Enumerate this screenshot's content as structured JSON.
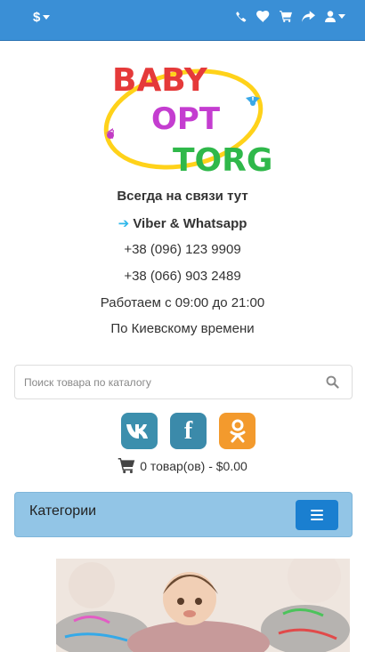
{
  "header": {
    "currency_symbol": "$",
    "icons": [
      "phone-icon",
      "heart-icon",
      "cart-icon",
      "share-icon",
      "user-icon"
    ]
  },
  "logo": {
    "line1": "BABY",
    "line2": "OPT",
    "line3": "TORG"
  },
  "contact": {
    "heading": "Всегда на связи тут",
    "arrow": "➔",
    "messengers": "Viber & Whatsapp",
    "phone1": "+38 (096) 123 9909",
    "phone2": "+38 (066) 903 2489",
    "hours": "Работаем с 09:00 до 21:00",
    "timezone": "По Киевскому времени"
  },
  "search": {
    "placeholder": "Поиск товара по каталогу"
  },
  "social": {
    "vk": "vk",
    "fb": "f",
    "ok": "ok"
  },
  "cart": {
    "summary": "0 товар(ов) - $0.00"
  },
  "categories": {
    "title": "Категории"
  },
  "colors": {
    "topbar": "#3a8fd6",
    "category_bar": "#92c5e6",
    "menu_button": "#1a7fd0",
    "vk": "#3c8fad",
    "facebook": "#3b8aaa",
    "odnoklassniki": "#f39a2d"
  }
}
